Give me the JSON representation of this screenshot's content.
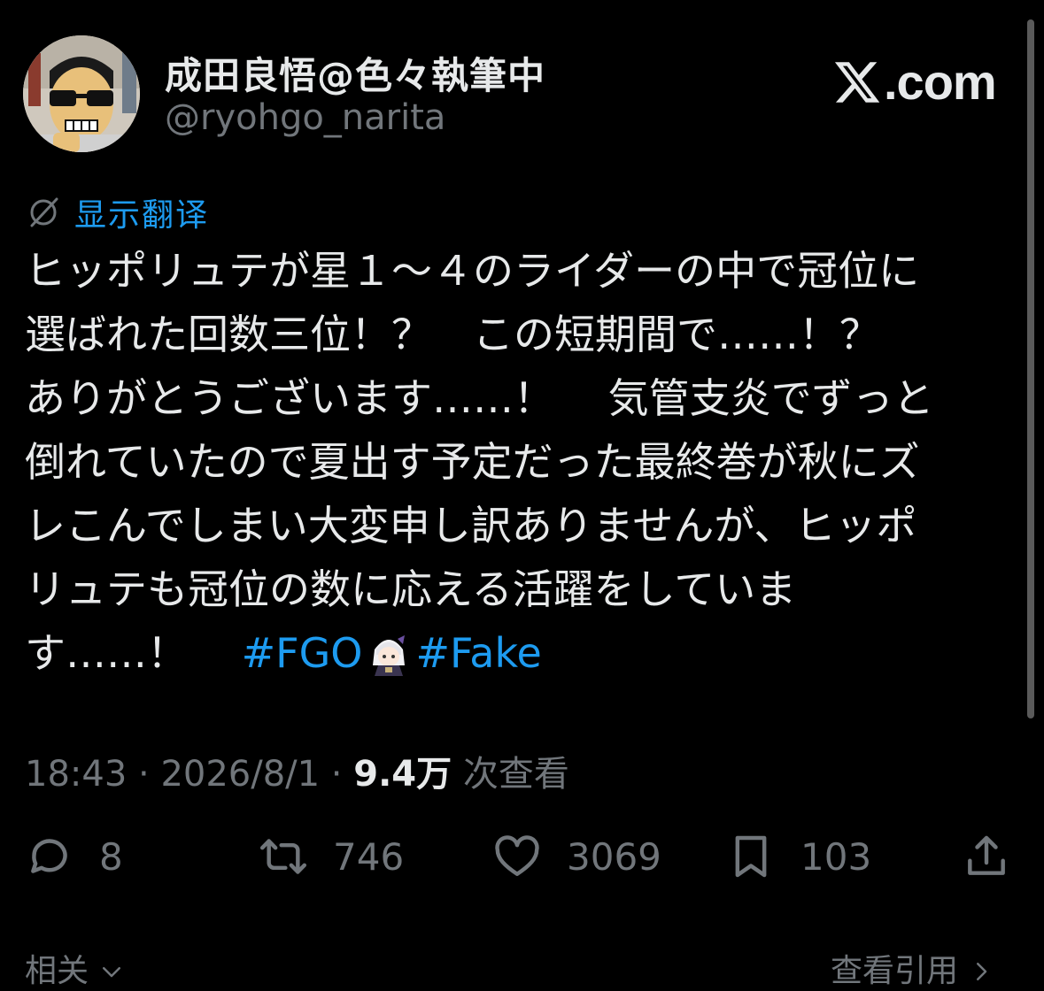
{
  "author": {
    "display_name": "成田良悟@色々執筆中",
    "handle": "@ryohgo_narita",
    "avatar_icon": "avatar-image"
  },
  "brand": {
    "logo_icon": "x-logo-icon",
    "text": ".com"
  },
  "translate": {
    "icon": "globe-slash-icon",
    "label": "显示翻译"
  },
  "tweet": {
    "lines": [
      "ヒッポリュテが星１～４のライダーの中で冠位に",
      "選ばれた回数三位！？　この短期間で……！？",
      "ありがとうございます……！　 気管支炎でずっと",
      "倒れていたので夏出す予定だった最終巻が秋にズ",
      "レこんでしまい大変申し訳ありませんが、ヒッポ",
      "リュテも冠位の数に応える活躍をしていま"
    ],
    "last_line_text": "す……！　 ",
    "hashtag_1": "#FGO",
    "emoji_icon": "character-sticker-icon",
    "hashtag_2": "#Fake"
  },
  "meta": {
    "time": "18:43",
    "sep_1": " · ",
    "date": "2026/8/1",
    "sep_2": " · ",
    "views_count": "9.4万",
    "views_label": " 次查看"
  },
  "actions": {
    "reply": {
      "icon": "reply-icon",
      "count": "8"
    },
    "retweet": {
      "icon": "retweet-icon",
      "count": "746"
    },
    "like": {
      "icon": "heart-icon",
      "count": "3069"
    },
    "bookmark": {
      "icon": "bookmark-icon",
      "count": "103"
    },
    "share": {
      "icon": "share-icon"
    }
  },
  "footer": {
    "related_label": "相关",
    "quotes_label": "查看引用"
  },
  "colors": {
    "background": "#000000",
    "text": "#e7e9ea",
    "muted": "#71767b",
    "accent": "#1d9bf0"
  }
}
